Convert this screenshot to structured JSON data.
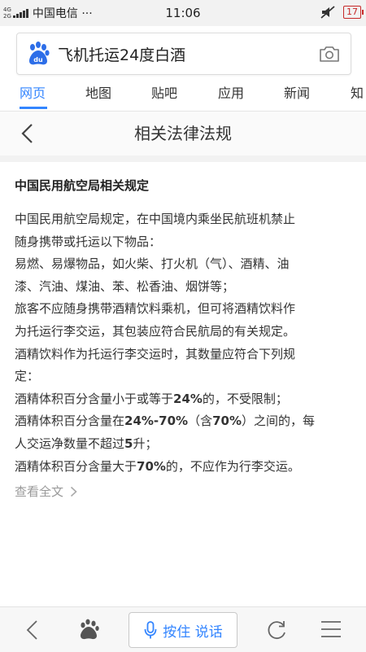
{
  "status_bar": {
    "network_top": "4G",
    "network_bottom": "2G",
    "carrier": "中国电信 ···",
    "time": "11:06",
    "battery": "17"
  },
  "search": {
    "query": "飞机托运24度白酒"
  },
  "tabs": [
    {
      "label": "网页",
      "active": true
    },
    {
      "label": "地图"
    },
    {
      "label": "贴吧"
    },
    {
      "label": "应用"
    },
    {
      "label": "新闻"
    },
    {
      "label": "知"
    }
  ],
  "header": {
    "title": "相关法律法规"
  },
  "content": {
    "section_title": "中国民用航空局相关规定",
    "lines": [
      "中国民用航空局规定，在中国境内乘坐民航班机禁止",
      "随身携带或托运以下物品：",
      "易燃、易爆物品，如火柴、打火机（气）、酒精、油",
      "漆、汽油、煤油、苯、松香油、烟饼等；",
      "旅客不应随身携带酒精饮料乘机，但可将酒精饮料作",
      "为托运行李交运，其包装应符合民航局的有关规定。",
      "酒精饮料作为托运行李交运时，其数量应符合下列规",
      "定：",
      "酒精体积百分含量小于或等于24%的，不受限制；",
      "酒精体积百分含量在24%-70%（含70%）之间的，每",
      "人交运净数量不超过5升；",
      "酒精体积百分含量大于70%的，不应作为行李交运。"
    ],
    "read_more": "查看全文"
  },
  "bottom_bar": {
    "voice_label": "按住 说话"
  },
  "colors": {
    "accent": "#3385ff",
    "battery_low": "#c62828"
  },
  "icons": [
    "back-icon",
    "baidu-paw-icon",
    "microphone-icon",
    "refresh-icon",
    "menu-icon",
    "camera-icon"
  ]
}
